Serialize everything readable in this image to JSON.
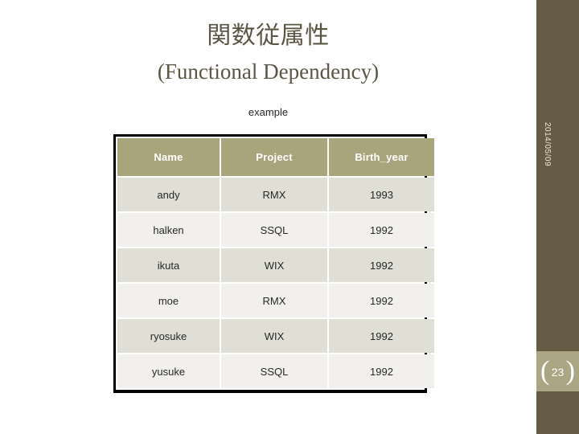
{
  "slide": {
    "title_main": "関数従属性",
    "title_sub": "(Functional Dependency)",
    "caption": "example",
    "background_color": "#ffffff",
    "title_color": "#5b5644"
  },
  "table": {
    "columns": [
      "Name",
      "Project",
      "Birth_year"
    ],
    "rows": [
      [
        "andy",
        "RMX",
        "1993"
      ],
      [
        "halken",
        "SSQL",
        "1992"
      ],
      [
        "ikuta",
        "WIX",
        "1992"
      ],
      [
        "moe",
        "RMX",
        "1992"
      ],
      [
        "ryosuke",
        "WIX",
        "1992"
      ],
      [
        "yusuke",
        "SSQL",
        "1992"
      ]
    ],
    "header_bg": "#a8a47b",
    "header_text_color": "#ffffff",
    "row_bg_even": "#dfdfd5",
    "row_bg_odd": "#f1f0ec",
    "border_color": "#000000"
  },
  "sidebar": {
    "date": "2014/05/09",
    "page_number": "23",
    "bracket_left": "(",
    "bracket_right": ")",
    "bg_color": "#665c45",
    "page_block_color": "#aaa582"
  }
}
